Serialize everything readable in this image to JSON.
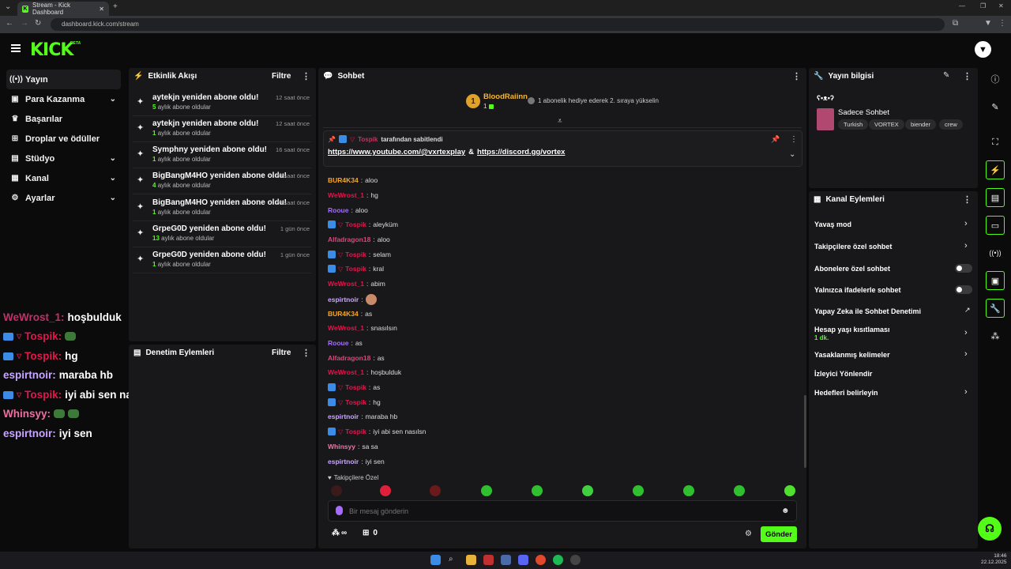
{
  "browser": {
    "tab_title": "Stream - Kick Dashboard",
    "url": "dashboard.kick.com/stream"
  },
  "app": {
    "logo": "KICK",
    "beta": "BETA",
    "avatar_icon": "kick-shield-icon"
  },
  "sidebar": {
    "items": [
      {
        "label": "Yayın",
        "icon": "broadcast-icon",
        "active": true
      },
      {
        "label": "Para Kazanma",
        "icon": "wallet-icon",
        "chevron": true
      },
      {
        "label": "Başarılar",
        "icon": "trophy-icon"
      },
      {
        "label": "Droplar ve ödüller",
        "icon": "gift-icon"
      },
      {
        "label": "Stüdyo",
        "icon": "studio-icon",
        "chevron": true
      },
      {
        "label": "Kanal",
        "icon": "channel-icon",
        "chevron": true
      },
      {
        "label": "Ayarlar",
        "icon": "settings-icon",
        "chevron": true
      }
    ]
  },
  "overlay_chat": [
    {
      "user": "WeWrost_1:",
      "text": "hoşbulduk"
    },
    {
      "user": "Tospik:",
      "text": ""
    },
    {
      "user": "Tospik:",
      "text": "hg"
    },
    {
      "user": "espirtnoir:",
      "text": "maraba hb"
    },
    {
      "user": "Tospik:",
      "text": "iyi abi sen nasılsn"
    },
    {
      "user": "Whinsyy:",
      "text": ""
    },
    {
      "user": "espirtnoir:",
      "text": "iyi sen"
    }
  ],
  "activity": {
    "title": "Etkinlik Akışı",
    "filter": "Filtre",
    "events": [
      {
        "title": "aytekjn yeniden abone oldu!",
        "months": "5",
        "sub": "aylık abone oldular",
        "time": "12 saat önce"
      },
      {
        "title": "aytekjn yeniden abone oldu!",
        "months": "1",
        "sub": "aylık abone oldular",
        "time": "12 saat önce"
      },
      {
        "title": "Symphny yeniden abone oldu!",
        "months": "1",
        "sub": "aylık abone oldular",
        "time": "16 saat önce"
      },
      {
        "title": "BigBangM4HO yeniden abone oldu!",
        "months": "4",
        "sub": "aylık abone oldular",
        "time": "20 saat önce"
      },
      {
        "title": "BigBangM4HO yeniden abone oldu!",
        "months": "1",
        "sub": "aylık abone oldular",
        "time": "20 saat önce"
      },
      {
        "title": "GrpeG0D yeniden abone oldu!",
        "months": "13",
        "sub": "aylık abone oldular",
        "time": "1 gün önce"
      },
      {
        "title": "GrpeG0D yeniden abone oldu!",
        "months": "1",
        "sub": "aylık abone oldular",
        "time": "1 gün önce"
      }
    ]
  },
  "moderation": {
    "title": "Denetim Eylemleri",
    "filter": "Filtre"
  },
  "chat": {
    "title": "Sohbet",
    "leader": {
      "rank": "1",
      "name": "BloodRaiinn",
      "count": "1",
      "note": "1 abonelik hediye ederek 2. sıraya yükselin"
    },
    "pinned": {
      "by_user": "Tospik",
      "by_text": "tarafından sabitlendi",
      "link1": "https://www.youtube.com/@vxrtexplay",
      "amp": "&",
      "link2": "https://discord.gg/vortex"
    },
    "messages": [
      {
        "user": "BUR4K34",
        "text": "aloo",
        "color": "c-or"
      },
      {
        "user": "WeWrost_1",
        "text": "hg",
        "color": "c-red"
      },
      {
        "user": "Rooue",
        "text": "aloo",
        "color": "c-pu"
      },
      {
        "user": "Tospik",
        "text": "aleyküm",
        "color": "c-red",
        "badges": true
      },
      {
        "user": "Alfadragon18",
        "text": "aloo",
        "color": "c-pk"
      },
      {
        "user": "Tospik",
        "text": "selam",
        "color": "c-red",
        "badges": true
      },
      {
        "user": "Tospik",
        "text": "kral",
        "color": "c-red",
        "badges": true
      },
      {
        "user": "WeWrost_1",
        "text": "abim",
        "color": "c-red"
      },
      {
        "user": "espirtnoir",
        "text": "",
        "color": "c-lv",
        "emote": true
      },
      {
        "user": "BUR4K34",
        "text": "as",
        "color": "c-or"
      },
      {
        "user": "WeWrost_1",
        "text": "snasılsın",
        "color": "c-red"
      },
      {
        "user": "Rooue",
        "text": "as",
        "color": "c-pu"
      },
      {
        "user": "Alfadragon18",
        "text": "as",
        "color": "c-pk"
      },
      {
        "user": "WeWrost_1",
        "text": "hoşbulduk",
        "color": "c-red"
      },
      {
        "user": "Tospik",
        "text": "as",
        "color": "c-red",
        "badges": true
      },
      {
        "user": "Tospik",
        "text": "hg",
        "color": "c-red",
        "badges": true
      },
      {
        "user": "espirtnoir",
        "text": "maraba hb",
        "color": "c-lv"
      },
      {
        "user": "Tospik",
        "text": "iyi abi sen nasılsn",
        "color": "c-red",
        "badges": true
      },
      {
        "user": "Whinsyy",
        "text": "sa sa",
        "color": "c-wh"
      },
      {
        "user": "espirtnoir",
        "text": "iyi sen",
        "color": "c-lv"
      }
    ],
    "followers_only": "Takipçilere Özel",
    "input_placeholder": "Bir mesaj gönderin",
    "points": "∞",
    "gift_count": "0",
    "send": "Gönder"
  },
  "stream_info": {
    "title": "Yayın bilgisi",
    "stream_title": "ʕ•ᴥ•ʔ",
    "category": "Sadece Sohbet",
    "tags": [
      "Turkish",
      "VORTEX",
      "biender",
      "crew"
    ]
  },
  "channel_actions": {
    "title": "Kanal Eylemleri",
    "items": [
      {
        "label": "Yavaş mod",
        "type": "chevron"
      },
      {
        "label": "Takipçilere özel sohbet",
        "type": "chevron"
      },
      {
        "label": "Abonelere özel sohbet",
        "type": "toggle"
      },
      {
        "label": "Yalnızca ifadelerle sohbet",
        "type": "toggle"
      },
      {
        "label": "Yapay Zeka ile Sohbet Denetimi",
        "type": "external"
      },
      {
        "label": "Hesap yaşı kısıtlaması",
        "sub": "1 dk.",
        "type": "chevron"
      },
      {
        "label": "Yasaklanmış kelimeler",
        "type": "chevron"
      },
      {
        "label": "İzleyici Yönlendir",
        "type": "none"
      },
      {
        "label": "Hedefleri belirleyin",
        "type": "chevron"
      }
    ]
  },
  "taskbar": {
    "time": "18:46",
    "date": "22.12.2025"
  },
  "colors": {
    "accent": "#53fc18",
    "panel": "#18181a",
    "background": "#0b0b0c"
  }
}
